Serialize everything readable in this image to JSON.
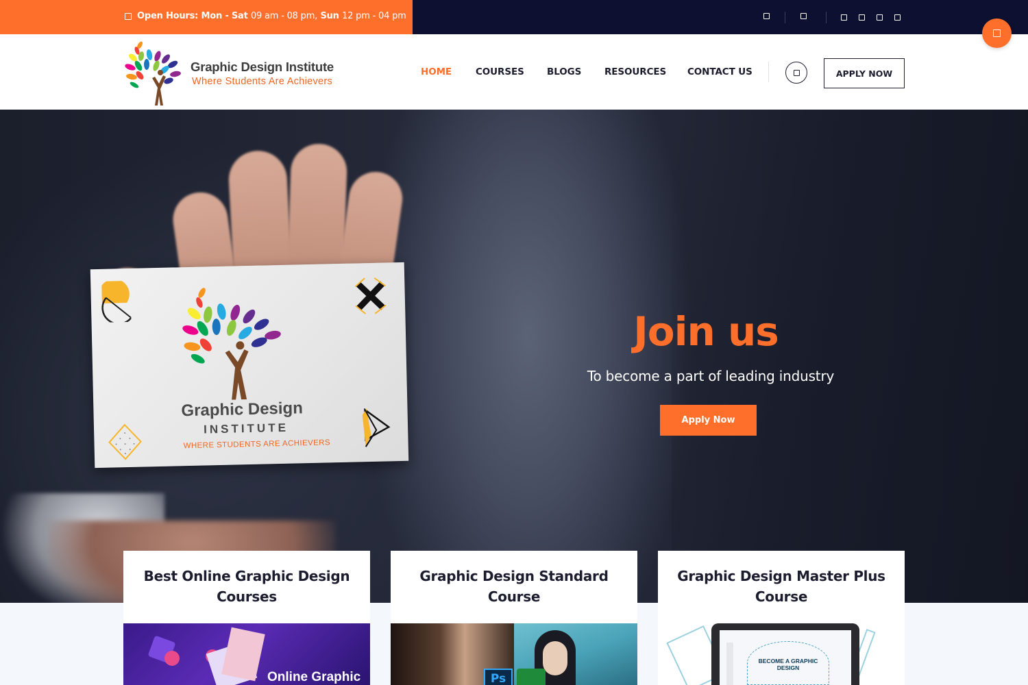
{
  "topbar": {
    "hours_label": "Open Hours: Mon - Sat",
    "hours_value": "09 am - 08 pm,",
    "hours_label2": "Sun",
    "hours_value2": "12 pm - 04 pm",
    "icons": [
      "phone-icon",
      "email-icon",
      "facebook-icon",
      "twitter-icon",
      "linkedin-icon",
      "instagram-icon"
    ]
  },
  "brand": {
    "name": "Graphic Design Institute",
    "tagline": "Where Students Are Achievers"
  },
  "nav": {
    "items": [
      "HOME",
      "COURSES",
      "BLOGS",
      "RESOURCES",
      "CONTACT US"
    ],
    "active": "HOME",
    "apply_label": "APPLY NOW"
  },
  "hero": {
    "title": "Join us",
    "subtitle": "To become a part of leading industry",
    "button": "Apply Now",
    "card": {
      "title": "Graphic Design",
      "subtitle": "INSTITUTE",
      "tagline": "WHERE STUDENTS ARE ACHIEVERS"
    }
  },
  "courses": [
    {
      "title_line1": "Best Online Graphic Design",
      "title_line2": "Courses",
      "thumb_text": "Online Graphic"
    },
    {
      "title_line1": "Graphic Design Standard",
      "title_line2": "Course",
      "thumb_text": "Ps"
    },
    {
      "title_line1": "Graphic Design Master Plus",
      "title_line2": "Course",
      "thumb_text": "BECOME A GRAPHIC DESIGN"
    }
  ],
  "colors": {
    "accent": "#fe6f2c",
    "dark": "#0d1030",
    "text": "#1c1c2e"
  }
}
